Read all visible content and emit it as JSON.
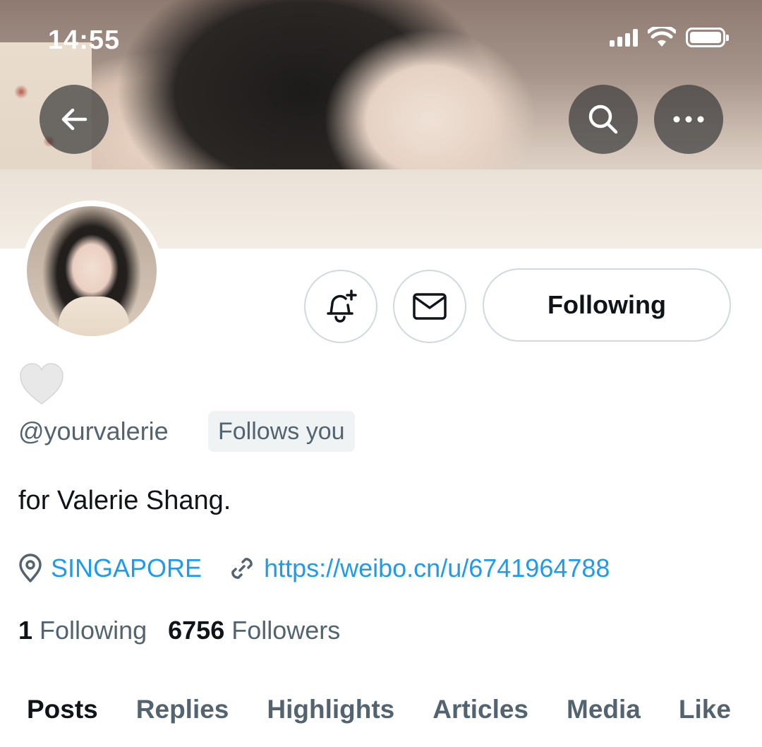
{
  "status_bar": {
    "time": "14:55",
    "icons": [
      "signal-icon",
      "wifi-icon",
      "battery-icon"
    ]
  },
  "banner": {
    "back_icon": "arrow-left-icon",
    "search_icon": "search-icon",
    "more_icon": "more-horizontal-icon"
  },
  "profile": {
    "display_name_emoji": "🤍",
    "handle": "@yourvalerie",
    "follows_you_badge": "Follows you",
    "bio": "for Valerie Shang.",
    "location": "SINGAPORE",
    "website": "https://weibo.cn/u/6741964788",
    "following_count": "1",
    "following_label": "Following",
    "followers_count": "6756",
    "followers_label": "Followers"
  },
  "actions": {
    "notify_icon": "bell-plus-icon",
    "message_icon": "envelope-icon",
    "follow_button_label": "Following"
  },
  "tabs": [
    {
      "label": "Posts",
      "active": true
    },
    {
      "label": "Replies",
      "active": false
    },
    {
      "label": "Highlights",
      "active": false
    },
    {
      "label": "Articles",
      "active": false
    },
    {
      "label": "Media",
      "active": false
    },
    {
      "label": "Like",
      "active": false
    }
  ],
  "colors": {
    "link": "#1d9bf0",
    "secondary_text": "#536471",
    "primary_text": "#0f1419",
    "border": "#cfd9de",
    "badge_bg": "#eff3f4"
  }
}
